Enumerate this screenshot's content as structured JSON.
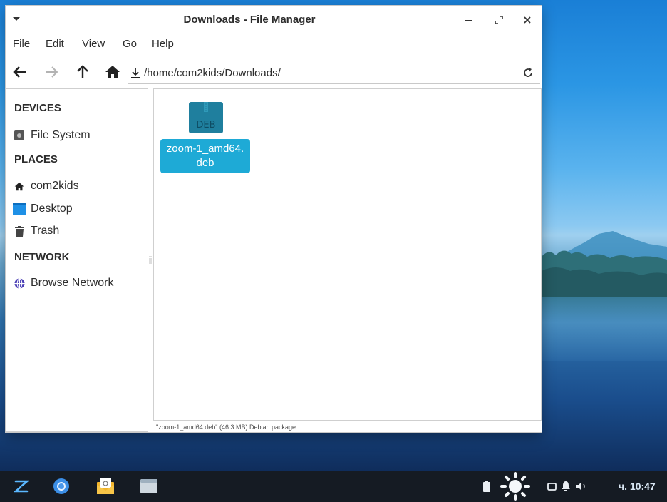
{
  "window": {
    "title": "Downloads - File Manager",
    "minimize": "–",
    "close": "×"
  },
  "menubar": {
    "items": [
      "File",
      "Edit",
      "View",
      "Go",
      "Help"
    ]
  },
  "toolbar": {
    "path": "/home/com2kids/Downloads/"
  },
  "sidebar": {
    "sections": [
      {
        "title": "DEVICES",
        "items": [
          {
            "label": "File System",
            "icon": "drive-icon"
          }
        ]
      },
      {
        "title": "PLACES",
        "items": [
          {
            "label": "com2kids",
            "icon": "home-icon"
          },
          {
            "label": "Desktop",
            "icon": "desktop-folder-icon"
          },
          {
            "label": "Trash",
            "icon": "trash-icon"
          }
        ]
      },
      {
        "title": "NETWORK",
        "items": [
          {
            "label": "Browse Network",
            "icon": "network-icon"
          }
        ]
      }
    ]
  },
  "files": [
    {
      "label_line1": "zoom-1_amd64.",
      "label_line2": "deb",
      "icon_text": "DEB",
      "selected": true
    }
  ],
  "statusbar": {
    "text": "\"zoom-1_amd64.deb\" (46.3 MB) Debian package"
  },
  "taskbar": {
    "clock": "ч. 10:47",
    "apps": [
      "zorin-menu-icon",
      "chromium-icon",
      "mail-icon",
      "files-icon"
    ]
  },
  "colors": {
    "selection": "#1eaad6",
    "deb_icon": "#1f7f9e",
    "taskbar": "#151b23"
  }
}
